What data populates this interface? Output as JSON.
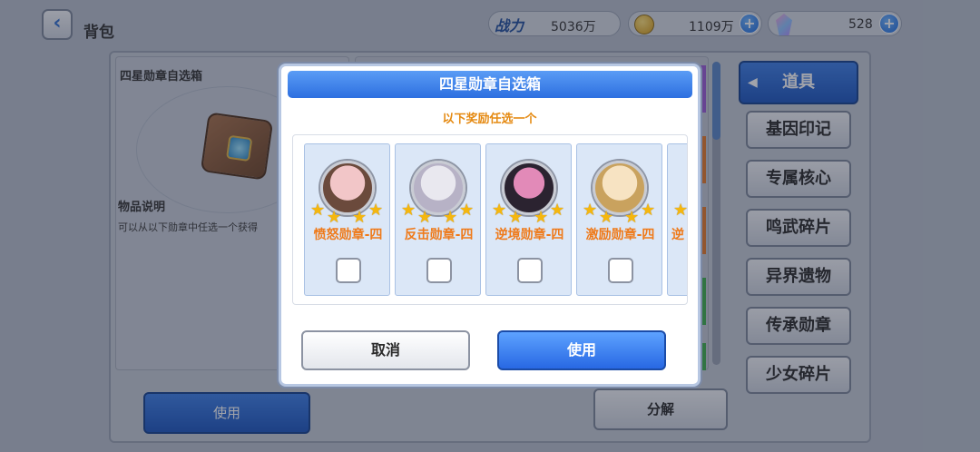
{
  "header": {
    "title": "背包",
    "power_label": "战力",
    "power_value": "5036万",
    "coins_value": "1109万",
    "gems_value": "528"
  },
  "info_panel": {
    "item_title": "四星勋章自选箱",
    "desc_title": "物品说明",
    "desc_text": "可以从以下勋章中任选一个获得"
  },
  "side_tabs": [
    {
      "label": "道具",
      "active": true
    },
    {
      "label": "基因印记"
    },
    {
      "label": "专属核心"
    },
    {
      "label": "鸣武碎片"
    },
    {
      "label": "异界遗物"
    },
    {
      "label": "传承勋章"
    },
    {
      "label": "少女碎片"
    }
  ],
  "bottom_buttons": {
    "use": "使用",
    "decompose": "分解"
  },
  "dialog": {
    "title": "四星勋章自选箱",
    "subtitle": "以下奖励任选一个",
    "cancel": "取消",
    "confirm": "使用",
    "rewards": [
      {
        "label": "愤怒勋章-四",
        "stars": 4,
        "avatar_colors": [
          "#f2c6c8",
          "#6b4a3c"
        ]
      },
      {
        "label": "反击勋章-四",
        "stars": 4,
        "avatar_colors": [
          "#e9e8ef",
          "#b7b2c6"
        ]
      },
      {
        "label": "逆境勋章-四",
        "stars": 4,
        "avatar_colors": [
          "#e28ab8",
          "#2b2330"
        ]
      },
      {
        "label": "激励勋章-四",
        "stars": 4,
        "avatar_colors": [
          "#f7e3c2",
          "#c9a25e"
        ]
      },
      {
        "label": "逆",
        "stars": 4,
        "partial": true
      }
    ]
  },
  "colors": {
    "accent_blue": "#2d6fe0",
    "star_gold": "#f5b70e",
    "label_orange": "#ef7a1a"
  }
}
